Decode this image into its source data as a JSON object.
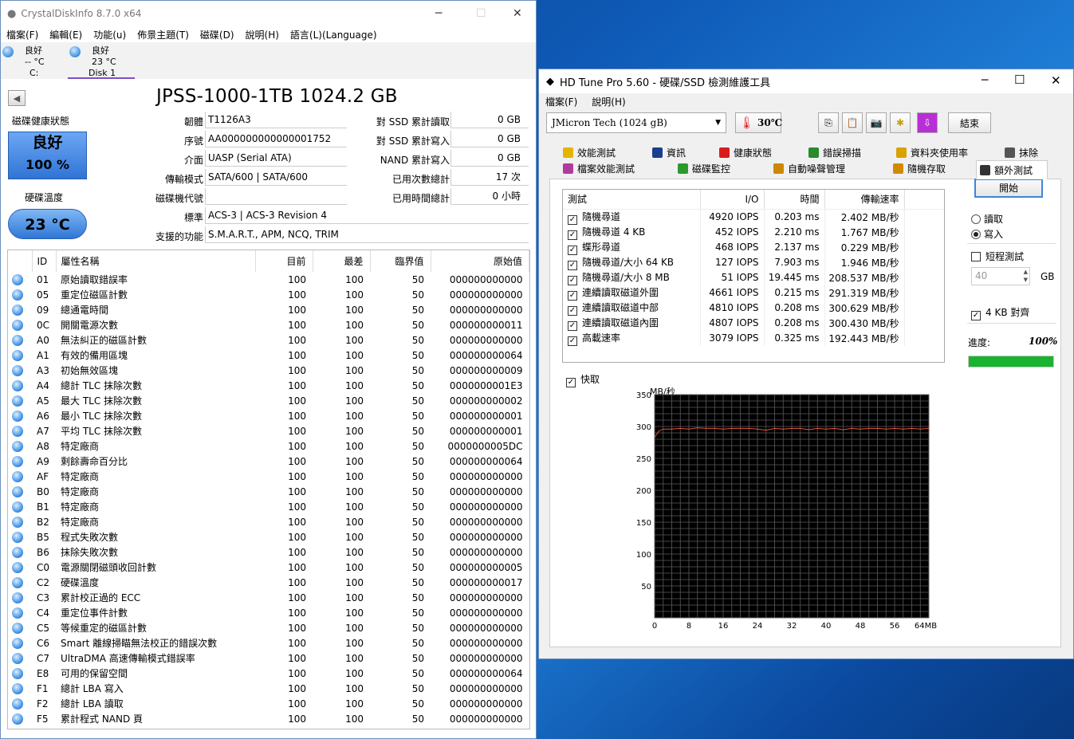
{
  "cdi": {
    "title": "CrystalDiskInfo 8.7.0 x64",
    "menu": [
      "檔案(F)",
      "編輯(E)",
      "功能(u)",
      "佈景主題(T)",
      "磁碟(D)",
      "說明(H)",
      "語言(L)(Language)"
    ],
    "disks": [
      {
        "status": "良好",
        "temp": "-- °C",
        "name": "C:"
      },
      {
        "status": "良好",
        "temp": "23 °C",
        "name": "Disk 1"
      }
    ],
    "model": "JPSS-1000-1TB 1024.2 GB",
    "health_label": "磁碟健康狀態",
    "health_status": "良好",
    "health_pct": "100 %",
    "temp_label": "硬碟溫度",
    "temp_value": "23 °C",
    "fields": {
      "firmware_l": "韌體",
      "firmware": "T1126A3",
      "serial_l": "序號",
      "serial": "AA000000000000001752",
      "iface_l": "介面",
      "iface": "UASP (Serial ATA)",
      "mode_l": "傳輸模式",
      "mode": "SATA/600 | SATA/600",
      "letter_l": "磁碟機代號",
      "letter": "",
      "std_l": "標準",
      "std": "ACS-3 | ACS-3 Revision 4",
      "feat_l": "支援的功能",
      "feat": "S.M.A.R.T., APM, NCQ, TRIM"
    },
    "right": {
      "r1_l": "對 SSD 累計讀取",
      "r1": "0 GB",
      "r2_l": "對 SSD 累計寫入",
      "r2": "0 GB",
      "r3_l": "NAND 累計寫入",
      "r3": "0 GB",
      "r4_l": "已用次數總計",
      "r4": "17 次",
      "r5_l": "已用時間總計",
      "r5": "0 小時"
    },
    "cols": [
      "ID",
      "屬性名稱",
      "目前",
      "最差",
      "臨界值",
      "原始值"
    ],
    "rows": [
      [
        "01",
        "原始讀取錯誤率",
        "100",
        "100",
        "50",
        "000000000000"
      ],
      [
        "05",
        "重定位磁區計數",
        "100",
        "100",
        "50",
        "000000000000"
      ],
      [
        "09",
        "總通電時間",
        "100",
        "100",
        "50",
        "000000000000"
      ],
      [
        "0C",
        "開關電源次數",
        "100",
        "100",
        "50",
        "000000000011"
      ],
      [
        "A0",
        "無法糾正的磁區計數",
        "100",
        "100",
        "50",
        "000000000000"
      ],
      [
        "A1",
        "有效的備用區塊",
        "100",
        "100",
        "50",
        "000000000064"
      ],
      [
        "A3",
        "初始無效區塊",
        "100",
        "100",
        "50",
        "000000000009"
      ],
      [
        "A4",
        "總計 TLC 抹除次數",
        "100",
        "100",
        "50",
        "0000000001E3"
      ],
      [
        "A5",
        "最大 TLC 抹除次數",
        "100",
        "100",
        "50",
        "000000000002"
      ],
      [
        "A6",
        "最小 TLC 抹除次數",
        "100",
        "100",
        "50",
        "000000000001"
      ],
      [
        "A7",
        "平均 TLC 抹除次數",
        "100",
        "100",
        "50",
        "000000000001"
      ],
      [
        "A8",
        "特定廠商",
        "100",
        "100",
        "50",
        "0000000005DC"
      ],
      [
        "A9",
        "剩餘壽命百分比",
        "100",
        "100",
        "50",
        "000000000064"
      ],
      [
        "AF",
        "特定廠商",
        "100",
        "100",
        "50",
        "000000000000"
      ],
      [
        "B0",
        "特定廠商",
        "100",
        "100",
        "50",
        "000000000000"
      ],
      [
        "B1",
        "特定廠商",
        "100",
        "100",
        "50",
        "000000000000"
      ],
      [
        "B2",
        "特定廠商",
        "100",
        "100",
        "50",
        "000000000000"
      ],
      [
        "B5",
        "程式失敗次數",
        "100",
        "100",
        "50",
        "000000000000"
      ],
      [
        "B6",
        "抹除失敗次數",
        "100",
        "100",
        "50",
        "000000000000"
      ],
      [
        "C0",
        "電源關閉磁頭收回計數",
        "100",
        "100",
        "50",
        "000000000005"
      ],
      [
        "C2",
        "硬碟溫度",
        "100",
        "100",
        "50",
        "000000000017"
      ],
      [
        "C3",
        "累計校正過的 ECC",
        "100",
        "100",
        "50",
        "000000000000"
      ],
      [
        "C4",
        "重定位事件計數",
        "100",
        "100",
        "50",
        "000000000000"
      ],
      [
        "C5",
        "等候重定的磁區計數",
        "100",
        "100",
        "50",
        "000000000000"
      ],
      [
        "C6",
        "Smart 離線掃瞄無法校正的錯誤次數",
        "100",
        "100",
        "50",
        "000000000000"
      ],
      [
        "C7",
        "UltraDMA 高速傳輸模式錯誤率",
        "100",
        "100",
        "50",
        "000000000000"
      ],
      [
        "E8",
        "可用的保留空間",
        "100",
        "100",
        "50",
        "000000000064"
      ],
      [
        "F1",
        "總計 LBA 寫入",
        "100",
        "100",
        "50",
        "000000000000"
      ],
      [
        "F2",
        "總計 LBA 讀取",
        "100",
        "100",
        "50",
        "000000000000"
      ],
      [
        "F5",
        "累計程式 NAND 頁",
        "100",
        "100",
        "50",
        "000000000000"
      ]
    ]
  },
  "hdt": {
    "title": "HD Tune Pro 5.60 - 硬碟/SSD 檢測維護工具",
    "menu": [
      "檔案(F)",
      "說明(H)"
    ],
    "drive": "JMicron Tech (1024 gB)",
    "temp": "30℃",
    "exit": "結束",
    "tabs_top": [
      "效能測試",
      "資訊",
      "健康狀態",
      "錯誤掃描",
      "資料夾使用率",
      "抹除"
    ],
    "tabs_bot": [
      "檔案效能測試",
      "磁碟監控",
      "自動噪聲管理",
      "隨機存取",
      "額外測試"
    ],
    "cols": [
      "測試",
      "I/O",
      "時間",
      "傳輸速率"
    ],
    "rows": [
      [
        "隨機尋道",
        "4920 IOPS",
        "0.203 ms",
        "2.402 MB/秒"
      ],
      [
        "隨機尋道 4 KB",
        "452 IOPS",
        "2.210 ms",
        "1.767 MB/秒"
      ],
      [
        "蝶形尋道",
        "468 IOPS",
        "2.137 ms",
        "0.229 MB/秒"
      ],
      [
        "隨機尋道/大小 64 KB",
        "127 IOPS",
        "7.903 ms",
        "1.946 MB/秒"
      ],
      [
        "隨機尋道/大小 8 MB",
        "51 IOPS",
        "19.445 ms",
        "208.537 MB/秒"
      ],
      [
        "連續讀取磁道外圍",
        "4661 IOPS",
        "0.215 ms",
        "291.319 MB/秒"
      ],
      [
        "連續讀取磁道中部",
        "4810 IOPS",
        "0.208 ms",
        "300.629 MB/秒"
      ],
      [
        "連續讀取磁道內圍",
        "4807 IOPS",
        "0.208 ms",
        "300.430 MB/秒"
      ],
      [
        "高載速率",
        "3079 IOPS",
        "0.325 ms",
        "192.443 MB/秒"
      ]
    ],
    "start": "開始",
    "read": "讀取",
    "write": "寫入",
    "short": "短程測試",
    "gb_value": "40",
    "gb_unit": "GB",
    "align": "4 KB 對齊",
    "progress_l": "進度:",
    "progress": "100%",
    "progress_value": 1.0,
    "cache": "快取",
    "accent": "#1bb231"
  },
  "chart_data": {
    "type": "line",
    "ylabel": "MB/秒",
    "xunit": "MB",
    "ylim": [
      0,
      350
    ],
    "xlim": [
      0,
      64
    ],
    "yticks": [
      50,
      100,
      150,
      200,
      250,
      300,
      350
    ],
    "xticks": [
      "0",
      "8",
      "16",
      "24",
      "32",
      "40",
      "48",
      "56",
      "64MB"
    ],
    "series": [
      {
        "x": [
          0,
          1,
          2,
          4,
          6,
          8,
          10,
          12,
          14,
          16,
          18,
          20,
          22,
          24,
          26,
          28,
          30,
          32,
          34,
          36,
          38,
          40,
          42,
          44,
          46,
          48,
          50,
          52,
          54,
          56,
          58,
          60,
          62,
          64
        ],
        "y": [
          283,
          293,
          296,
          296,
          297,
          296,
          298,
          297,
          297,
          296,
          297,
          297,
          297,
          296,
          294,
          297,
          296,
          297,
          297,
          295,
          297,
          296,
          297,
          295,
          297,
          296,
          297,
          297,
          296,
          297,
          296,
          297,
          296,
          297
        ]
      }
    ]
  }
}
